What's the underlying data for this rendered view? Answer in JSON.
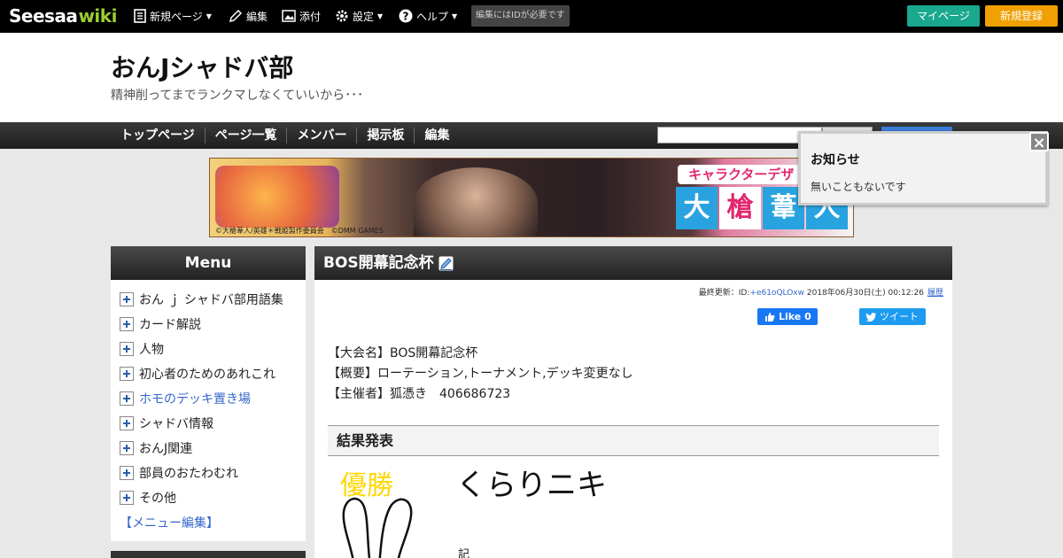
{
  "topbar": {
    "logo_part1": "Seesaa",
    "logo_part2": "wiki",
    "new_page": "新規ページ",
    "edit": "編集",
    "attach": "添付",
    "settings": "設定",
    "help": "ヘルプ",
    "id_note": "編集にはIDが必要です",
    "mypage": "マイページ",
    "register": "新規登録"
  },
  "header": {
    "title": "おんJシャドバ部",
    "subtitle": "精神削ってまでランクマしなくていいから･･･"
  },
  "nav": {
    "items": [
      "トップページ",
      "ページ一覧",
      "メンバー",
      "掲示板",
      "編集"
    ]
  },
  "banner": {
    "tag": "キャラクターデザ",
    "name_chars": [
      "大",
      "槍",
      "葦",
      "人"
    ],
    "credit": "©大槍葦人/英雄＊戦姫製作委員会　©DMM GAMES"
  },
  "sidebar": {
    "heading": "Menu",
    "items": [
      {
        "label": "おん ｊ シャドバ部用語集",
        "link": false
      },
      {
        "label": "カード解説",
        "link": false
      },
      {
        "label": "人物",
        "link": false
      },
      {
        "label": "初心者のためのあれこれ",
        "link": false
      },
      {
        "label": "ホモのデッキ置き場",
        "link": true
      },
      {
        "label": "シャドバ情報",
        "link": false
      },
      {
        "label": "おんJ関連",
        "link": false
      },
      {
        "label": "部員のおたわむれ",
        "link": false
      },
      {
        "label": "その他",
        "link": false
      }
    ],
    "menu_edit": "【メニュー編集】"
  },
  "page": {
    "title": "BOS開幕記念杯",
    "meta_prefix": "最終更新：ID:",
    "meta_uid": "+e61oQLOxw",
    "meta_date": " 2018年06月30日(土) 00:12:26",
    "meta_history": "履歴",
    "fb_label": "Like 0",
    "tw_label": "ツイート",
    "lines": [
      "【大会名】BOS開幕記念杯",
      "【概要】ローテーション,トーナメント,デッキ変更なし",
      "【主催者】狐憑き　406686723"
    ],
    "section_heading": "結果発表",
    "winner_label": "優勝",
    "winner_name": "くらりニキ",
    "small_glyph": "記"
  },
  "notice": {
    "title": "お知らせ",
    "body": "無いこともないです",
    "close": "×"
  },
  "colors": {
    "accent_green": "#1aa88e",
    "accent_orange": "#f0a000",
    "link_blue": "#3366cc",
    "winner_gold": "#ffd700"
  }
}
